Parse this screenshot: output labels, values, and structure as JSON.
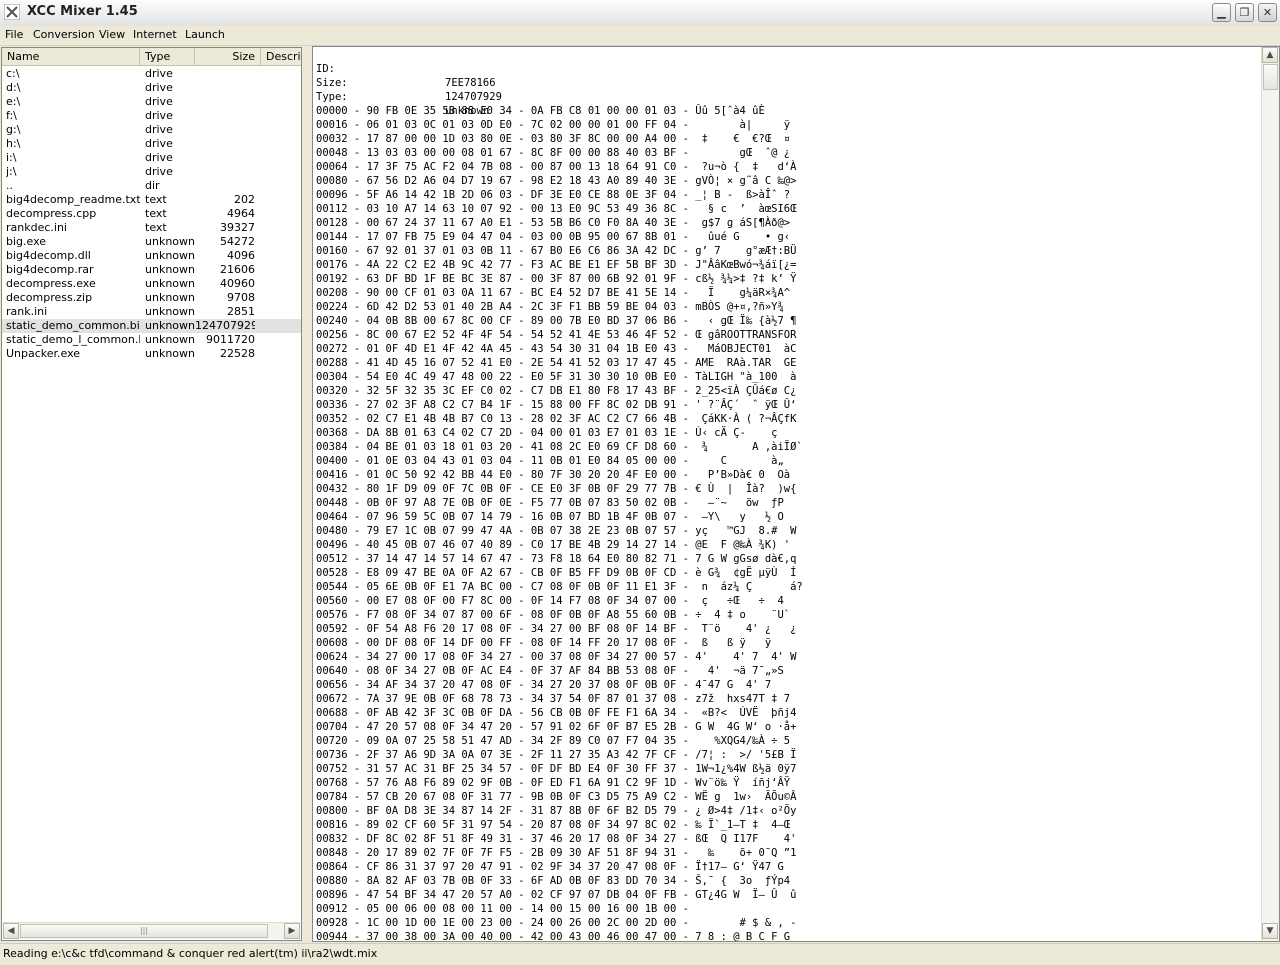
{
  "window": {
    "title": "XCC Mixer 1.45"
  },
  "menu": [
    "File",
    "Conversion",
    "View",
    "Internet",
    "Launch"
  ],
  "file_list": {
    "columns": [
      "Name",
      "Type",
      "Size",
      "Descripti"
    ],
    "rows": [
      {
        "name": "c:\\",
        "type": "drive",
        "size": ""
      },
      {
        "name": "d:\\",
        "type": "drive",
        "size": ""
      },
      {
        "name": "e:\\",
        "type": "drive",
        "size": ""
      },
      {
        "name": "f:\\",
        "type": "drive",
        "size": ""
      },
      {
        "name": "g:\\",
        "type": "drive",
        "size": ""
      },
      {
        "name": "h:\\",
        "type": "drive",
        "size": ""
      },
      {
        "name": "i:\\",
        "type": "drive",
        "size": ""
      },
      {
        "name": "j:\\",
        "type": "drive",
        "size": ""
      },
      {
        "name": "..",
        "type": "dir",
        "size": ""
      },
      {
        "name": "big4decomp_readme.txt",
        "type": "text",
        "size": "202"
      },
      {
        "name": "decompress.cpp",
        "type": "text",
        "size": "4964"
      },
      {
        "name": "rankdec.ini",
        "type": "text",
        "size": "39327"
      },
      {
        "name": "big.exe",
        "type": "unknown",
        "size": "54272"
      },
      {
        "name": "big4decomp.dll",
        "type": "unknown",
        "size": "4096"
      },
      {
        "name": "big4decomp.rar",
        "type": "unknown",
        "size": "21606"
      },
      {
        "name": "decompress.exe",
        "type": "unknown",
        "size": "40960"
      },
      {
        "name": "decompress.zip",
        "type": "unknown",
        "size": "9708"
      },
      {
        "name": "rank.ini",
        "type": "unknown",
        "size": "2851"
      },
      {
        "name": "static_demo_common.big",
        "type": "unknown",
        "size": "124707929",
        "selected": true
      },
      {
        "name": "static_demo_l_common.bin",
        "type": "unknown",
        "size": "9011720"
      },
      {
        "name": "Unpacker.exe",
        "type": "unknown",
        "size": "22528"
      }
    ]
  },
  "info": [
    {
      "label": "ID:",
      "value": "7EE78166"
    },
    {
      "label": "Size:",
      "value": "124707929"
    },
    {
      "label": "Type:",
      "value": "unknown"
    }
  ],
  "hex_lines": [
    "00000 - 90 FB 0E 35 5B 88 E0 34 - 0A FB C8 01 00 00 01 03 - Ûû 5[ˆà4 ûÈ",
    "00016 - 06 01 03 0C 01 03 0D E0 - 7C 02 00 00 01 00 FF 04 -        à|     ÿ",
    "00032 - 17 87 00 00 1D 03 80 0E - 03 80 3F 8C 00 00 A4 00 -  ‡    €  €?Œ  ¤",
    "00048 - 13 03 03 00 00 08 01 67 - 8C 8F 00 00 88 40 03 BF -        gŒ  ˆ@ ¿",
    "00064 - 17 3F 75 AC F2 04 7B 08 - 00 87 00 13 18 64 91 C0 -  ?u¬ò {  ‡   d‘À",
    "00080 - 67 56 D2 A6 04 D7 19 67 - 98 E2 18 43 A0 89 40 3E - gVÒ¦ × g˜â C ‰@>",
    "00096 - 5F A6 14 42 1B 2D 06 03 - DF 3E E0 CE 88 0E 3F 04 - _¦ B -  ß>àÎˆ ?",
    "00112 - 03 10 A7 14 63 10 07 92 - 00 13 E0 9C 53 49 36 8C -   § c  ’  àœSI6Œ",
    "00128 - 00 67 24 37 11 67 A0 E1 - 53 5B B6 C0 F0 8A 40 3E -  g$7 g áS[¶Àð@>",
    "00144 - 17 07 FB 75 E9 04 47 04 - 03 00 0B 95 00 67 8B 01 -   ûué G    • g‹",
    "00160 - 67 92 01 37 01 03 0B 11 - 67 B0 E6 C6 86 3A 42 DC - g’ 7    g°æÆ†:BÜ",
    "00176 - 4A 22 C2 E2 4B 9C 42 77 - F3 AC BE E1 EF 5B BF 3D - J\"ÂâKœBwó¬¾áï[¿=",
    "00192 - 63 DF BD 1F BE BC 3E 87 - 00 3F 87 00 6B 92 01 9F - cß½ ¾¼>‡ ?‡ k’ Ÿ",
    "00208 - 90 00 CF 01 03 0A 11 67 - BC E4 52 D7 BE 41 5E 14 -   Ï    g¼äR×¾A^",
    "00224 - 6D 42 D2 53 01 40 2B A4 - 2C 3F F1 BB 59 BE 04 03 - mBÒS @+¤,?ñ»Y¾",
    "00240 - 04 0B 8B 00 67 8C 00 CF - 89 00 7B E0 BD 37 06 B6 -   ‹ gŒ Ï‰ {à½7 ¶",
    "00256 - 8C 00 67 E2 52 4F 4F 54 - 54 52 41 4E 53 46 4F 52 - Œ gâROOTTRANSFOR",
    "00272 - 01 0F 4D E1 4F 42 4A 45 - 43 54 30 31 04 1B E0 43 -   MáOBJECT01  àC",
    "00288 - 41 4D 45 16 07 52 41 E0 - 2E 54 41 52 03 17 47 45 - AME  RAà.TAR  GE",
    "00304 - 54 E0 4C 49 47 48 00 22 - E0 5F 31 30 30 10 0B E0 - TàLIGH \"à_100  à",
    "00320 - 32 5F 32 35 3C EF C0 02 - C7 DB E1 80 F8 17 43 BF - 2_25<ïÀ ÇÛá€ø C¿",
    "00336 - 27 02 3F A8 C2 C7 B4 1F - 15 88 00 FF 8C 02 DB 91 - ' ?¨ÂÇ´  ˆ ÿŒ Û‘",
    "00352 - 02 C7 E1 4B 4B B7 C0 13 - 28 02 3F AC C2 C7 66 4B -  ÇáKK·À ( ?¬ÂÇfK",
    "00368 - DA 8B 01 63 C4 02 C7 2D - 04 00 01 03 E7 01 03 1E - Ú‹ cÄ Ç-    ç",
    "00384 - 04 BE 01 03 18 01 03 20 - 41 08 2C E0 69 CF D8 60 -  ¾       A ,àiÏØ`",
    "00400 - 01 0E 03 04 43 01 03 04 - 11 0B 01 E0 84 05 00 00 -     C       à„",
    "00416 - 01 0C 50 92 42 BB 44 E0 - 80 7F 30 20 20 4F E0 00 -   P’B»Dà€ 0  Oà",
    "00432 - 80 1F D9 09 0F 7C 0B 0F - CE E0 3F 0B 0F 29 77 7B - € Ù  |  Îà?  )w{",
    "00448 - 0B 0F 97 A8 7E 0B 0F 0E - F5 77 0B 07 83 50 02 0B -   —¨~   õw  ƒP",
    "00464 - 07 96 59 5C 0B 07 14 79 - 16 0B 07 BD 1B 4F 0B 07 -  –Y\\   y   ½ O",
    "00480 - 79 E7 1C 0B 07 99 47 4A - 0B 07 38 2E 23 0B 07 57 - yç   ™GJ  8.#  W",
    "00496 - 40 45 0B 07 46 07 40 89 - C0 17 BE 4B 29 14 27 14 - @E  F @‰À ¾K) '",
    "00512 - 37 14 47 14 57 14 67 47 - 73 F8 18 64 E0 80 82 71 - 7 G W gGsø dà€‚q",
    "00528 - E8 09 47 BE 0A 0F A2 67 - CB 0F B5 FF D9 0B 0F CD - è G¾  ¢gË µÿÙ  Í",
    "00544 - 05 6E 0B 0F E1 7A BC 00 - C7 08 0F 0B 0F 11 E1 3F -  n  áz¼ Ç      á?",
    "00560 - 00 E7 08 0F 00 F7 8C 00 - 0F 14 F7 08 0F 34 07 00 -  ç   ÷Œ   ÷  4",
    "00576 - F7 08 0F 34 07 87 00 6F - 08 0F 0B 0F A8 55 60 0B - ÷  4 ‡ o    ¨U`",
    "00592 - 0F 54 A8 F6 20 17 08 0F - 34 27 00 BF 08 0F 14 BF -  T¨ö    4' ¿   ¿",
    "00608 - 00 DF 08 0F 14 DF 00 FF - 08 0F 14 FF 20 17 08 0F -  ß   ß ÿ   ÿ",
    "00624 - 34 27 00 17 08 0F 34 27 - 00 37 08 0F 34 27 00 57 - 4'    4' 7  4' W",
    "00640 - 08 0F 34 27 0B 0F AC E4 - 0F 37 AF 84 BB 53 08 0F -   4'  ¬ä 7¯„»S",
    "00656 - 34 AF 34 37 20 47 08 0F - 34 27 20 37 08 0F 0B 0F - 4¯47 G  4' 7",
    "00672 - 7A 37 9E 0B 0F 68 78 73 - 34 37 54 0F 87 01 37 08 - z7ž  hxs47T ‡ 7",
    "00688 - 0F AB 42 3F 3C 0B 0F DA - 56 CB 0B 0F FE F1 6A 34 -  «B?<  ÚVË  þñj4",
    "00704 - 47 20 57 08 0F 34 47 20 - 57 91 02 6F 0F B7 E5 2B - G W  4G W‘ o ·å+",
    "00720 - 09 0A 07 25 58 51 47 AD - 34 2F 89 C0 07 F7 04 35 -    %XQG­4/‰À ÷ 5",
    "00736 - 2F 37 A6 9D 3A 0A 07 3E - 2F 11 27 35 A3 42 7F CF - /7¦ :  >/ '5£B Ï",
    "00752 - 31 57 AC 31 BF 25 34 57 - 0F DF BD E4 0F 30 FF 37 - 1W¬1¿%4W ß½ä 0ÿ7",
    "00768 - 57 76 A8 F6 89 02 9F 0B - 0F ED F1 6A 91 C2 9F 1D - Wv¨ö‰ Ÿ  íñj‘ÂŸ",
    "00784 - 57 CB 20 67 08 0F 31 77 - 9B 0B 0F C3 D5 75 A9 C2 - WË g  1w›  ÃÕu©Â",
    "00800 - BF 0A D8 3E 34 87 14 2F - 31 87 8B 0F 6F B2 D5 79 - ¿ Ø>4‡ /1‡‹ o²Õy",
    "00816 - 89 02 CF 60 5F 31 97 54 - 20 87 08 0F 34 97 8C 02 - ‰ Ï`_1—T ‡  4—Œ",
    "00832 - DF 8C 02 8F 51 8F 49 31 - 37 46 20 17 08 0F 34 27 - ßŒ  Q I17F    4'",
    "00848 - 20 17 89 02 7F 0F 7F F5 - 2B 09 30 AF 51 8F 94 31 -   ‰    õ+ 0¯Q ”1",
    "00864 - CF 86 31 37 97 20 47 91 - 02 9F 34 37 20 47 08 0F - Ï†17— G‘ Ÿ47 G",
    "00880 - 8A 82 AF 03 7B 0B 0F 33 - 6F AD 0B 0F 83 DD 70 34 - Š‚¯ {  3o­  ƒÝp4",
    "00896 - 47 54 BF 34 47 20 57 A0 - 02 CF 97 07 DB 04 0F FB - GT¿4G W  Ï— Û  û",
    "00912 - 05 00 06 00 08 00 11 00 - 14 00 15 00 16 00 1B 00 -",
    "00928 - 1C 00 1D 00 1E 00 23 00 - 24 00 26 00 2C 00 2D 00 -        # $ & , -",
    "00944 - 37 00 38 00 3A 00 40 00 - 42 00 43 00 46 00 47 00 - 7 8 : @ B C F G"
  ],
  "status": "Reading e:\\c&c tfd\\command & conquer red alert(tm) ii\\ra2\\wdt.mix"
}
